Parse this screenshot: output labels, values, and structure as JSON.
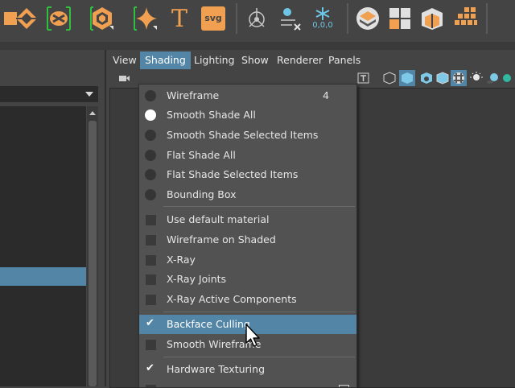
{
  "toolbar": {
    "icons": [
      "extrude-icon",
      "diamond-icon",
      "bevel-icon",
      "soccerball-icon",
      "star-icon",
      "text-icon",
      "svg-icon",
      "transform-icon",
      "snowflake-icon",
      "layers-icon",
      "grid-blocks-icon",
      "cube-icon",
      "checker-icon"
    ],
    "svg_label": "svg",
    "t_label": "T",
    "freeze_label": "0,0,0"
  },
  "viewport": {
    "menus": [
      "View",
      "Shading",
      "Lighting",
      "Show",
      "Renderer",
      "Panels"
    ],
    "active_menu": "Shading"
  },
  "shading_menu": {
    "radio_items": [
      {
        "label": "Wireframe",
        "hotkey": "4",
        "selected": false
      },
      {
        "label": "Smooth Shade All",
        "hotkey": "",
        "selected": true
      },
      {
        "label": "Smooth Shade Selected Items",
        "hotkey": "",
        "selected": false
      },
      {
        "label": "Flat Shade All",
        "hotkey": "",
        "selected": false
      },
      {
        "label": "Flat Shade Selected Items",
        "hotkey": "",
        "selected": false
      },
      {
        "label": "Bounding Box",
        "hotkey": "",
        "selected": false
      }
    ],
    "check_items_a": [
      {
        "label": "Use default material",
        "checked": false
      },
      {
        "label": "Wireframe on Shaded",
        "checked": false
      },
      {
        "label": "X-Ray",
        "checked": false
      },
      {
        "label": "X-Ray Joints",
        "checked": false
      },
      {
        "label": "X-Ray Active Components",
        "checked": false
      }
    ],
    "check_items_b": [
      {
        "label": "Backface Culling",
        "checked": true,
        "highlighted": true
      },
      {
        "label": "Smooth Wireframe",
        "checked": false
      }
    ],
    "check_items_c": [
      {
        "label": "Hardware Texturing",
        "checked": true
      }
    ]
  },
  "colors": {
    "highlight": "#5285a6",
    "accent": "#f0a050",
    "panel_bg": "#444444"
  }
}
